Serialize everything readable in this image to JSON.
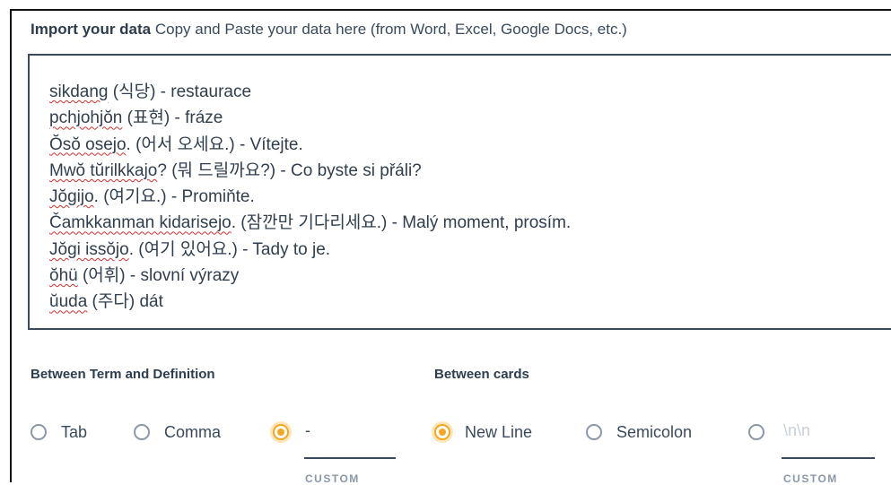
{
  "import": {
    "title": "Import your data",
    "subtitle": "Copy and Paste your data here (from Word, Excel, Google Docs, etc.)",
    "lines": [
      {
        "a": "sikdang",
        "b": " (식당) - restaurace"
      },
      {
        "a": "pchjohjŏn",
        "b": " (표현) - fráze"
      },
      {
        "a": "Ŏsŏ osejo",
        "b": ". (어서 오세요.) - Vítejte."
      },
      {
        "a": "Mwŏ tŭrilkkajo",
        "b": "? (뭐 드릴까요?) - Co byste si přáli?"
      },
      {
        "a": "Jŏgijo",
        "b": ". (여기요.) - Promiňte."
      },
      {
        "a": "Čamkkanman kidarisejo",
        "b": ". (잠깐만 기다리세요.) - Malý moment, prosím."
      },
      {
        "a": "Jŏgi issŏjo",
        "b": ". (여기 있어요.) - Tady to je."
      },
      {
        "a": "ŏhü",
        "b": " (어휘) - slovní výrazy"
      },
      {
        "a": "ŭuda",
        "b": " (주다) dát"
      }
    ]
  },
  "term_def": {
    "label": "Between Term and Definition",
    "options": [
      "Tab",
      "Comma"
    ],
    "custom_value": "-",
    "custom_caption": "CUSTOM"
  },
  "cards": {
    "label": "Between cards",
    "options": [
      "New Line",
      "Semicolon"
    ],
    "custom_placeholder": "\\n\\n",
    "custom_caption": "CUSTOM"
  },
  "colors": {
    "accent": "#f5a623",
    "text": "#2e3d4d",
    "border": "#3b4a5b"
  }
}
